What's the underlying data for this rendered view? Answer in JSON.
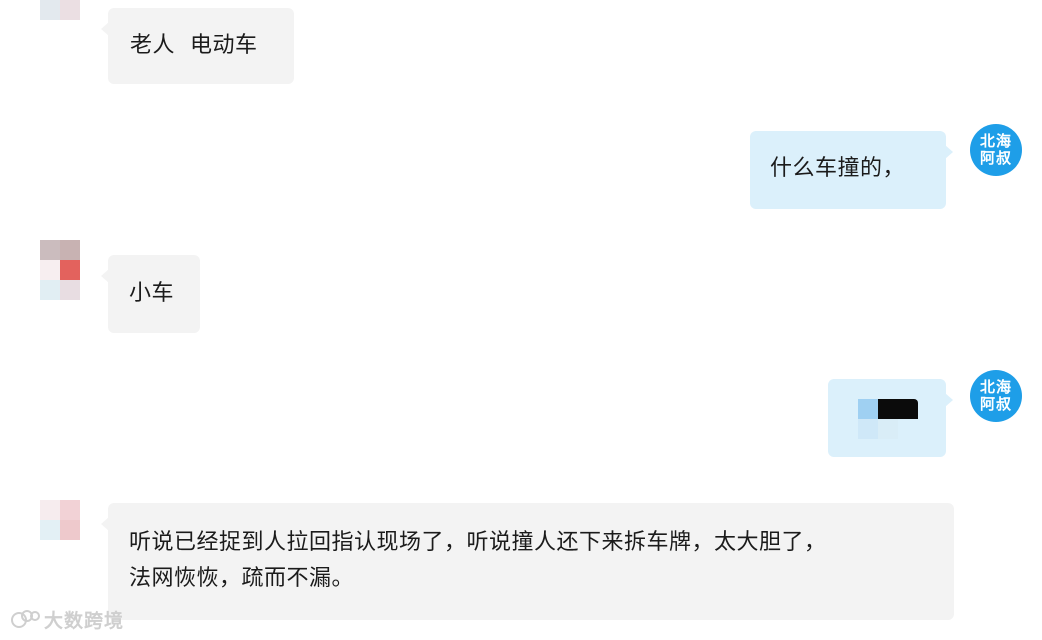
{
  "messages": [
    {
      "side": "in",
      "text": "老人  电动车"
    },
    {
      "side": "out",
      "text": "什么车撞的，"
    },
    {
      "side": "in",
      "text": "小车"
    },
    {
      "side": "out",
      "type": "sticker"
    },
    {
      "side": "in",
      "line1": "听说已经捉到人拉回指认现场了，听说撞人还下来拆车牌，太大胆了，",
      "line2": "法网恢恢，疏而不漏。"
    }
  ],
  "self_avatar": {
    "line1": "北海",
    "line2": "阿叔"
  },
  "watermark": {
    "text": "大数跨境"
  },
  "colors": {
    "incoming_bubble": "#f3f3f3",
    "outgoing_bubble": "#dbf0fb",
    "avatar_blue": "#1e9ee8"
  }
}
